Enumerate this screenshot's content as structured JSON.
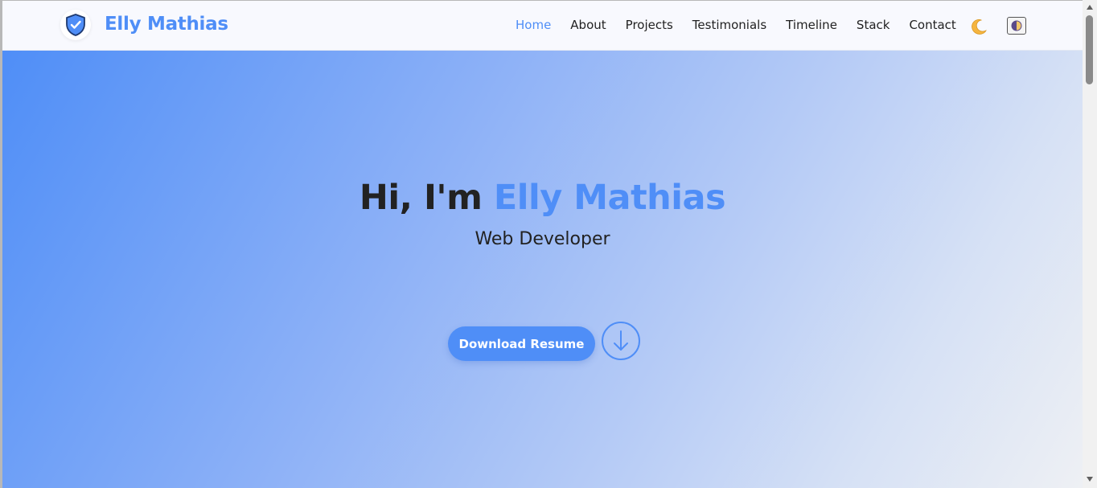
{
  "brand": {
    "name": "Elly Mathias"
  },
  "nav": {
    "items": [
      {
        "label": "Home",
        "active": true
      },
      {
        "label": "About",
        "active": false
      },
      {
        "label": "Projects",
        "active": false
      },
      {
        "label": "Testimonials",
        "active": false
      },
      {
        "label": "Timeline",
        "active": false
      },
      {
        "label": "Stack",
        "active": false
      },
      {
        "label": "Contact",
        "active": false
      }
    ],
    "icons": {
      "dark_mode": "moon-icon",
      "theme_toggle": "contrast-icon"
    }
  },
  "hero": {
    "greeting": "Hi, I'm",
    "name": "Elly Mathias",
    "role": "Web Developer",
    "button_label": "Download Resume",
    "scroll_icon": "arrow-down-icon"
  },
  "colors": {
    "accent": "#4f8ef7",
    "text": "#222222",
    "nav_bg": "#f8f9fe"
  }
}
